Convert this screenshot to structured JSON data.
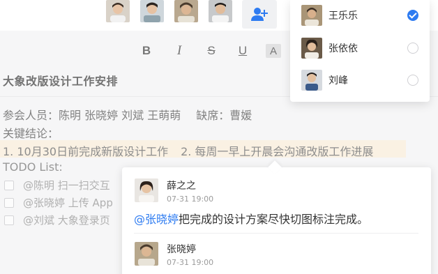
{
  "toolbar": {
    "bold": "B",
    "italic": "I",
    "strike": "S",
    "underline": "U",
    "highlight": "A"
  },
  "document": {
    "title": "大象改版设计工作安排",
    "attendees": "参会人员：陈明 张晓婷 刘斌 王萌萌",
    "absent": "缺席：曹媛",
    "conclusion_label": "关键结论：",
    "conclusion_1": "1. 10月30日前完成新版设计工作",
    "conclusion_2": "2. 每周一早上开晨会沟通改版工作进展",
    "todo_label": "TODO List:",
    "todos": [
      "@陈明 扫一扫交互",
      "@张晓婷 上传 App",
      "@刘斌 大象登录页"
    ]
  },
  "members": [
    {
      "name": "王乐乐",
      "selected": true
    },
    {
      "name": "张依依",
      "selected": false
    },
    {
      "name": "刘峰",
      "selected": false
    }
  ],
  "comments": [
    {
      "author": "薛之之",
      "time": "07-31 19:00",
      "mention": "@张晓婷",
      "text": "把完成的设计方案尽快切图标注完成。"
    },
    {
      "author": "张晓婷",
      "time": "07-31 19:00"
    }
  ],
  "colors": {
    "accent": "#2d7bf1",
    "highlight": "#fcefd9"
  },
  "icons": [
    "add-user-icon",
    "checkmark-icon"
  ]
}
